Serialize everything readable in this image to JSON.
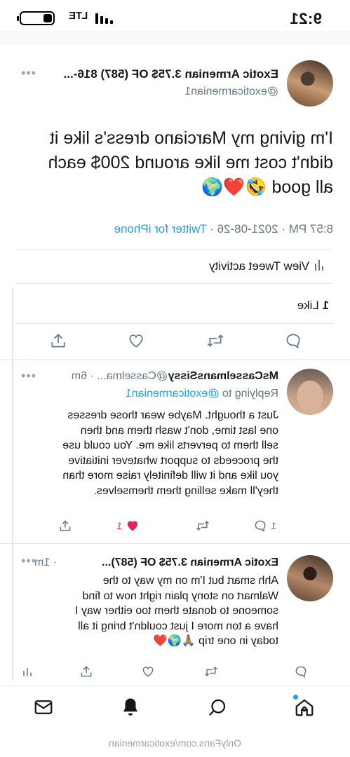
{
  "status_bar": {
    "time": "9:21",
    "carrier": "LTE"
  },
  "tweet": {
    "display_name": "Exotic Armenian 3.75$ OF (587) 816-...",
    "handle": "@exoticarmenian1",
    "text": "I'm giving my Marciano dress's like it\ndidn't cost me like around 200$ each\nall good 🤣❤️🌍",
    "time": "8:57 PM · 2021-08-26 · ",
    "source": "Twitter for iPhone",
    "activity_label": "View Tweet activity",
    "likes_count": "1",
    "likes_label": "Like"
  },
  "replies": [
    {
      "display_name": "MsCasselmansSissy",
      "handle_time": "@Casselma... · 6m",
      "replying_prefix": "Replying to ",
      "replying_to": "@exoticarmenian1",
      "text": "Just a thought. Maybe wear those dresses\none last time, don't wash them and then\nsell them to perverts like me. You could use\nthe proceeds to support whatever initiative\nyou like and it will definitely raise more than\nthey'll make selling them themselves.",
      "reply_count": "1",
      "like_count": "1"
    },
    {
      "display_name": "Exotic Armenian 3.75$ OF (587)...",
      "handle_time": "· 1m",
      "text": "Ahh smart but I'm on my way to the\nWalmart on stony plain right now to find\nsomeone to donate them too either way I\nhave a ton more I just couldn't bring it all\ntoday in one trip 🙏🏽🌍❤️"
    }
  ],
  "watermark": "OnlyFans.com/exoticarmenian",
  "colors": {
    "accent": "#1da1f2",
    "like_red": "#e0245e",
    "muted": "#657786"
  },
  "icons": [
    "reply-icon",
    "retweet-icon",
    "like-icon",
    "share-icon",
    "analytics-icon",
    "home-icon",
    "search-icon",
    "notifications-icon",
    "messages-icon"
  ]
}
